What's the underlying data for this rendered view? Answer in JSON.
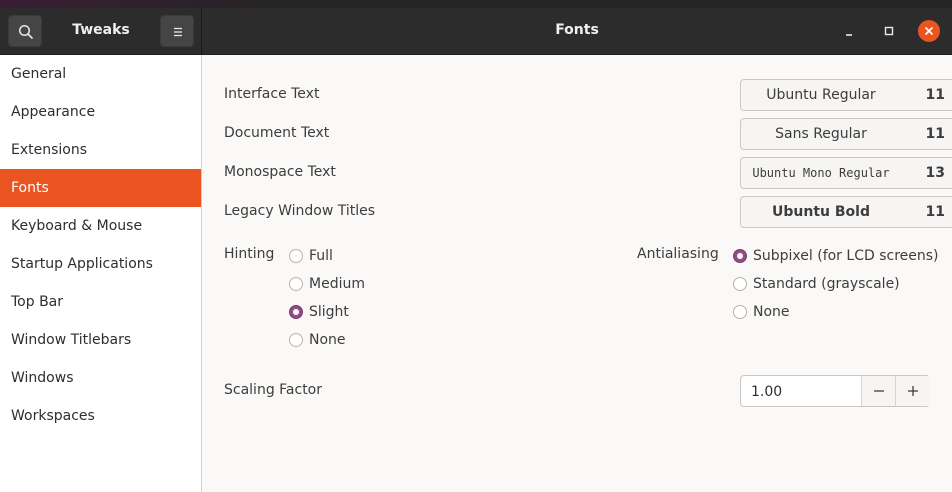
{
  "header": {
    "app_title": "Tweaks",
    "page_title": "Fonts"
  },
  "sidebar": {
    "items": [
      {
        "label": "General"
      },
      {
        "label": "Appearance"
      },
      {
        "label": "Extensions"
      },
      {
        "label": "Fonts",
        "active": true
      },
      {
        "label": "Keyboard & Mouse"
      },
      {
        "label": "Startup Applications"
      },
      {
        "label": "Top Bar"
      },
      {
        "label": "Window Titlebars"
      },
      {
        "label": "Windows"
      },
      {
        "label": "Workspaces"
      }
    ]
  },
  "fonts": {
    "interface": {
      "label": "Interface Text",
      "font": "Ubuntu Regular",
      "size": "11"
    },
    "document": {
      "label": "Document Text",
      "font": "Sans Regular",
      "size": "11"
    },
    "monospace": {
      "label": "Monospace Text",
      "font": "Ubuntu Mono Regular",
      "size": "13"
    },
    "legacy": {
      "label": "Legacy Window Titles",
      "font": "Ubuntu Bold",
      "size": "11"
    }
  },
  "hinting": {
    "label": "Hinting",
    "options": [
      "Full",
      "Medium",
      "Slight",
      "None"
    ],
    "selected": "Slight"
  },
  "antialiasing": {
    "label": "Antialiasing",
    "options": [
      "Subpixel (for LCD screens)",
      "Standard (grayscale)",
      "None"
    ],
    "selected": "Subpixel (for LCD screens)"
  },
  "scaling": {
    "label": "Scaling Factor",
    "value": "1.00"
  },
  "colors": {
    "accent": "#e95420",
    "radio_checked": "#924d8b",
    "header_bg": "#2c2c2c"
  }
}
